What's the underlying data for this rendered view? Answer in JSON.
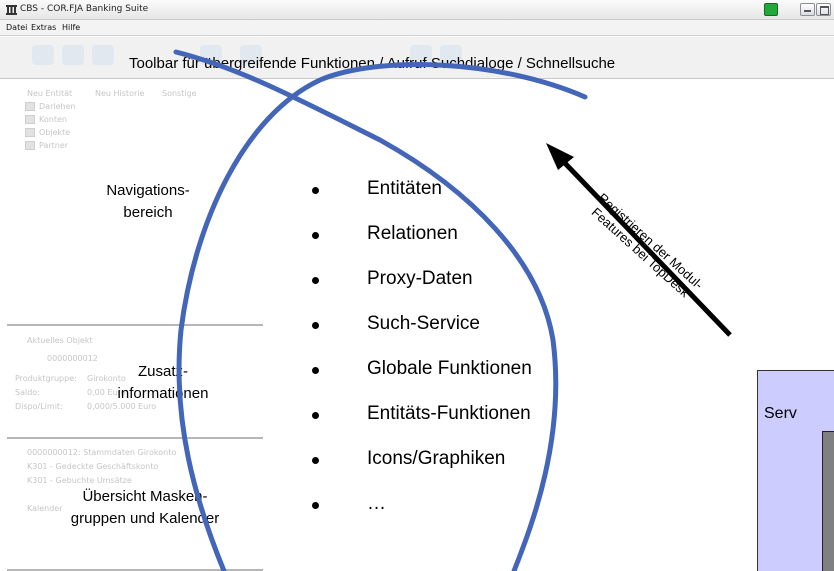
{
  "window": {
    "title": "CBS - COR.FJA Banking Suite",
    "icon": "bank-icon"
  },
  "menu": [
    "Datei",
    "Extras",
    "Hilfe"
  ],
  "toolbar": {
    "caption": "Toolbar für übergreifende Funktionen / Aufruf Suchdialoge / Schnellsuche"
  },
  "sections": {
    "navigation": {
      "label_line1": "Navigations-",
      "label_line2": "bereich"
    },
    "info": {
      "label_line1": "Zusatz-",
      "label_line2": "informationen"
    },
    "masks": {
      "label_line1": "Übersicht Masken-",
      "label_line2": "gruppen und Kalender"
    }
  },
  "nav_tree": {
    "toolbar_items": [
      "Neu Entität",
      "Neu Historie",
      "Sonstige"
    ],
    "items": [
      "Darlehen",
      "Konten",
      "Objekte",
      "Partner"
    ]
  },
  "info_panel": {
    "heading": "Aktuelles Objekt",
    "object": "0000000012",
    "rows": [
      {
        "label": "Produktgruppe:",
        "value": "Girokonto"
      },
      {
        "label": "Saldo:",
        "value": "0,00 Euro"
      },
      {
        "label": "Dispo/Limit:",
        "value": "0,000/5.000 Euro"
      }
    ]
  },
  "masks_panel": {
    "heading": "0000000012: Stammdaten Girokonto",
    "items": [
      "K301 - Gedeckte Geschäftskonto",
      "K301 - Gebuchte Umsätze",
      "Kalender"
    ]
  },
  "bullets": [
    "Entitäten",
    "Relationen",
    "Proxy-Daten",
    "Such-Service",
    "Globale Funktionen",
    "Entitäts-Funktionen",
    "Icons/Graphiken",
    "…"
  ],
  "arrow_annotation": {
    "line1": "Registrieren der Modul-",
    "line2": "Features bei TopDesk"
  },
  "server_box": {
    "label": "Serv"
  },
  "colors": {
    "ellipse_stroke": "#4466b8",
    "server_fill": "#ccccff",
    "server_inner": "#808080",
    "status_green": "#23a83a"
  }
}
